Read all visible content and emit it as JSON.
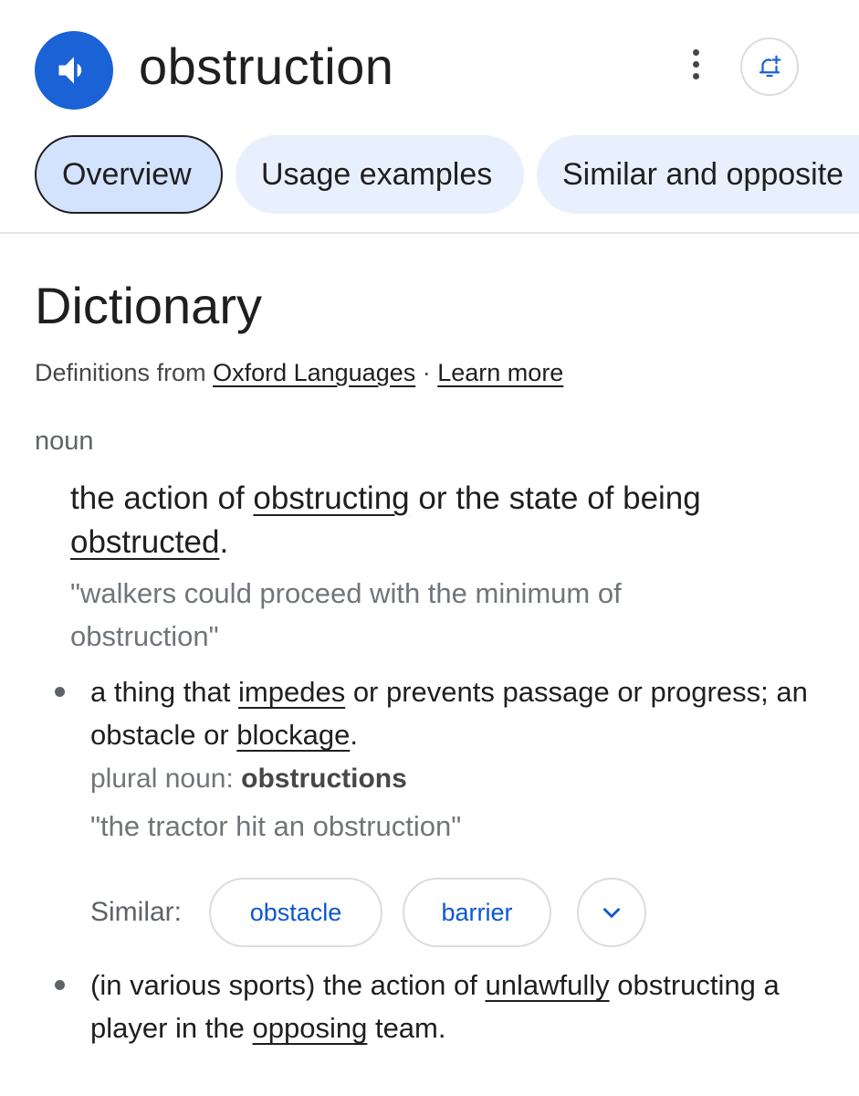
{
  "header": {
    "word": "obstruction",
    "speaker_icon": "volume-icon",
    "more_icon": "more-vert-icon",
    "alert_icon": "add-alert-bell-icon"
  },
  "tabs": [
    {
      "label": "Overview",
      "active": true
    },
    {
      "label": "Usage examples",
      "active": false
    },
    {
      "label": "Similar and opposite",
      "active": false
    }
  ],
  "dictionary": {
    "title": "Dictionary",
    "source_prefix": "Definitions from ",
    "source_link": "Oxford Languages",
    "separator": " · ",
    "learn_more": "Learn more"
  },
  "entry": {
    "part_of_speech": "noun",
    "main_definition": {
      "part1": "the action of ",
      "link1": "obstructing",
      "part2": " or the state of being ",
      "link2": "obstructed",
      "part3": "."
    },
    "main_example": "\"walkers could proceed with the minimum of obstruction\"",
    "sense2": {
      "part1": "a thing that ",
      "link1": "impedes",
      "part2": " or prevents passage or progress; an obstacle or ",
      "link2": "blockage",
      "part3": ".",
      "plural_label": "plural noun: ",
      "plural_value": "obstructions",
      "example": "\"the tractor hit an obstruction\"",
      "similar_label": "Similar:",
      "similar_chips": [
        "obstacle",
        "barrier"
      ],
      "expand_icon": "chevron-down-icon"
    },
    "sense3": {
      "part1": "(in various sports) the action of ",
      "link1": "unlawfully",
      "part2": " obstructing a player in the ",
      "link2": "opposing",
      "part3": " team."
    }
  },
  "colors": {
    "accent_blue": "#1a62d6",
    "chip_text": "#0b57d0",
    "tab_bg": "#e8f0fe",
    "tab_active_bg": "#d3e3fd"
  }
}
